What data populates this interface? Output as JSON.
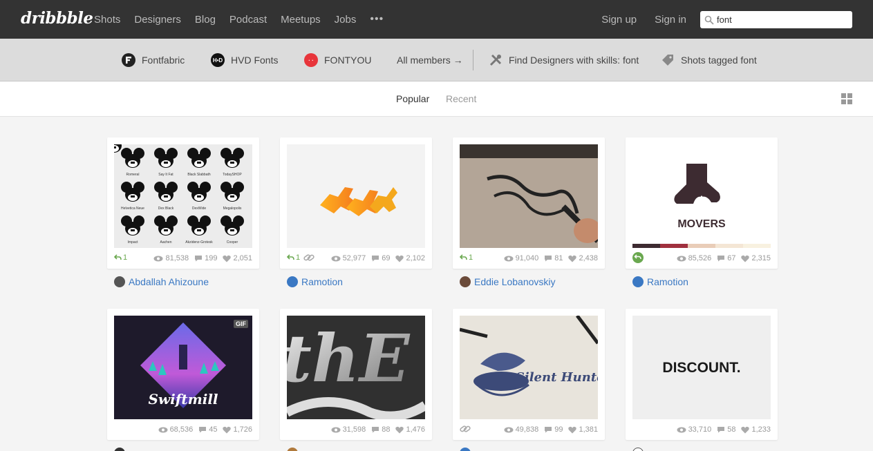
{
  "nav": {
    "logo": "dribbble",
    "links": [
      "Shots",
      "Designers",
      "Blog",
      "Podcast",
      "Meetups",
      "Jobs"
    ],
    "more": "•••",
    "signup": "Sign up",
    "signin": "Sign in",
    "search_value": "font"
  },
  "related": {
    "items": [
      {
        "label": "Fontfabric",
        "icon": "fontfabric-logo-icon"
      },
      {
        "label": "HVD Fonts",
        "icon": "hvd-logo-icon"
      },
      {
        "label": "FONTYOU",
        "icon": "fontyou-logo-icon"
      }
    ],
    "all_members": "All members →",
    "find_designers": "Find Designers with skills: font",
    "shots_tagged": "Shots tagged font"
  },
  "filters": {
    "popular": "Popular",
    "recent": "Recent"
  },
  "shots": [
    {
      "views": "81,538",
      "comments": "199",
      "likes": "2,051",
      "rebounds": "1",
      "player": "Abdallah Ahizoune"
    },
    {
      "views": "52,977",
      "comments": "69",
      "likes": "2,102",
      "rebounds": "1",
      "player": "Ramotion"
    },
    {
      "views": "91,040",
      "comments": "81",
      "likes": "2,438",
      "rebounds": "1",
      "player": "Eddie Lobanovskiy"
    },
    {
      "views": "85,526",
      "comments": "67",
      "likes": "2,315",
      "rebounds": "",
      "player": "Ramotion",
      "thumb_text": "MOVERS"
    },
    {
      "views": "68,536",
      "comments": "45",
      "likes": "1,726",
      "badge": "GIF",
      "thumb_text": "Swiftmill"
    },
    {
      "views": "31,598",
      "comments": "88",
      "likes": "1,476",
      "thumb_text": "thE"
    },
    {
      "views": "49,838",
      "comments": "99",
      "likes": "1,381",
      "thumb_text": "Silent Hunter"
    },
    {
      "views": "33,710",
      "comments": "58",
      "likes": "1,233",
      "thumb_text": "DISCOUNT."
    }
  ],
  "mickey_labels": [
    "Romeral",
    "Say It Fat",
    "Black Slabbath",
    "TodaySHOP",
    "Helvetica Neue",
    "Dex Black",
    "DexWide",
    "Megalopolis",
    "Impact",
    "Aachen",
    "Akzidenz-Grotesk",
    "Cooper"
  ],
  "colors": {
    "accent": "#3a78c3",
    "rebound": "#6aa84f",
    "topbar": "#333333"
  }
}
